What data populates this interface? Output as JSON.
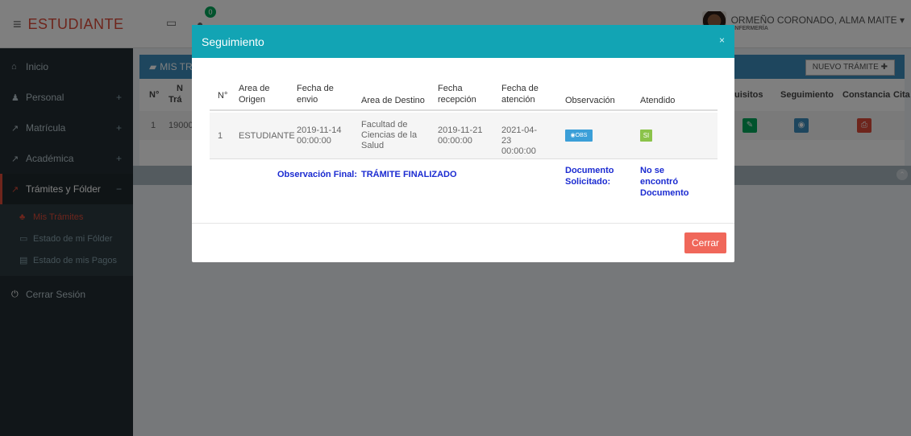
{
  "topbar": {
    "brand": "ESTUDIANTE",
    "notifications_count": "0",
    "user_name": "ORMEÑO CORONADO, ALMA MAITE",
    "user_role": "ENFERMERÍA"
  },
  "sidebar": {
    "items": [
      {
        "label": "Inicio"
      },
      {
        "label": "Personal",
        "toggle": "+"
      },
      {
        "label": "Matrícula",
        "toggle": "+"
      },
      {
        "label": "Académica",
        "toggle": "+"
      },
      {
        "label": "Trámites y Fólder",
        "toggle": "−"
      }
    ],
    "subitems": [
      {
        "label": "Mis Trámites"
      },
      {
        "label": "Estado de mi Fólder"
      },
      {
        "label": "Estado de mis Pagos"
      }
    ],
    "logout": "Cerrar Sesión"
  },
  "background": {
    "box_title": "MIS TR",
    "new_button": "NUEVO TRÁMITE",
    "headers": [
      "N°",
      "N",
      "Trá",
      "uisitos",
      "Seguimiento",
      "Constancia",
      "Cita"
    ],
    "row": {
      "num": "1",
      "code": "19000"
    }
  },
  "modal": {
    "title": "Seguimiento",
    "close_x": "×",
    "headers": [
      "N°",
      "Area de Origen",
      "Fecha de envio",
      "Area de Destino",
      "Fecha recepción",
      "Fecha de atención",
      "Observación",
      "Atendido"
    ],
    "row": {
      "num": "1",
      "origen": "ESTUDIANTE",
      "envio": "2019-11-14 00:00:00",
      "destino": "Facultad de Ciencias de la Salud",
      "recepcion": "2019-11-21 00:00:00",
      "atencion": "2021-04-23 00:00:00",
      "obs_button": "OBS",
      "atendido": "SI"
    },
    "final_label": "Observación Final:",
    "final_value": "TRÁMITE FINALIZADO",
    "doc_label": "Documento Solicitado:",
    "doc_value": "No se encontró Documento",
    "close_button": "Cerrar"
  },
  "colors": {
    "brand": "#dd4b39",
    "modal_header": "#12a4b4",
    "sidebar": "#222d32",
    "close_button": "#f0675a",
    "link_blue": "#1b2bd1"
  }
}
